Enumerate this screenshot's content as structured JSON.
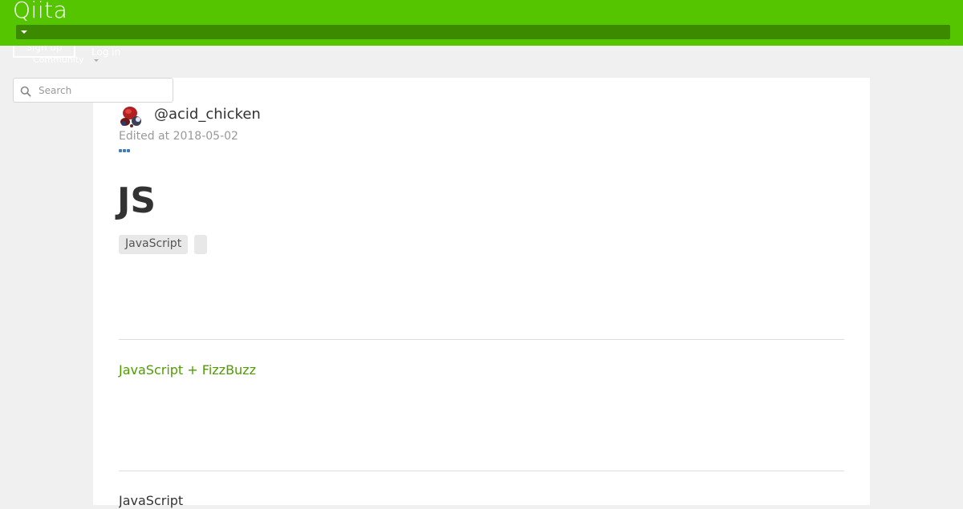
{
  "header": {
    "logo_text": "Qiita",
    "brand_color": "#55c500",
    "dropdown_icon": "caret-down-icon",
    "signup_label": "Sign up",
    "login_label": "Log in",
    "community_label": "Community"
  },
  "search": {
    "placeholder": "Search",
    "value": "",
    "icon": "search-icon"
  },
  "article": {
    "author": "@acid_chicken",
    "edited": "Edited at 2018-05-02",
    "more_icon": "more-dots-icon",
    "title": "JS",
    "tags": [
      "JavaScript",
      ""
    ],
    "toc_link": "JavaScript + FizzBuzz",
    "section_heading": "JavaScript"
  }
}
